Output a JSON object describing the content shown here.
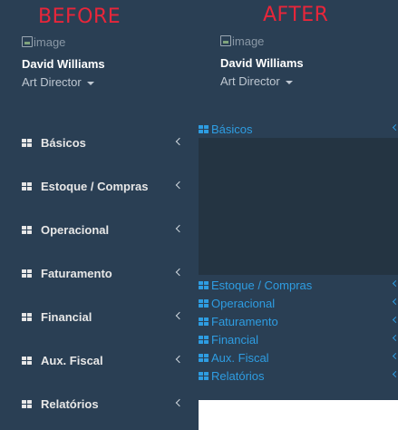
{
  "labels": {
    "before": "BEFORE",
    "after": "AFTER"
  },
  "colors": {
    "sidebar_bg": "#2a3f54",
    "submenu_bg": "#243442",
    "link_blue": "#2e9de2",
    "caption_red": "#e8263a"
  },
  "profile": {
    "image_alt": "image",
    "name": "David Williams",
    "role": "Art Director"
  },
  "menu": [
    {
      "label": "Básicos",
      "icon": "grid-icon"
    },
    {
      "label": "Estoque / Compras",
      "icon": "grid-icon"
    },
    {
      "label": "Operacional",
      "icon": "grid-icon"
    },
    {
      "label": "Faturamento",
      "icon": "grid-icon"
    },
    {
      "label": "Financial",
      "icon": "grid-icon"
    },
    {
      "label": "Aux. Fiscal",
      "icon": "grid-icon"
    },
    {
      "label": "Relatórios",
      "icon": "grid-icon"
    }
  ]
}
